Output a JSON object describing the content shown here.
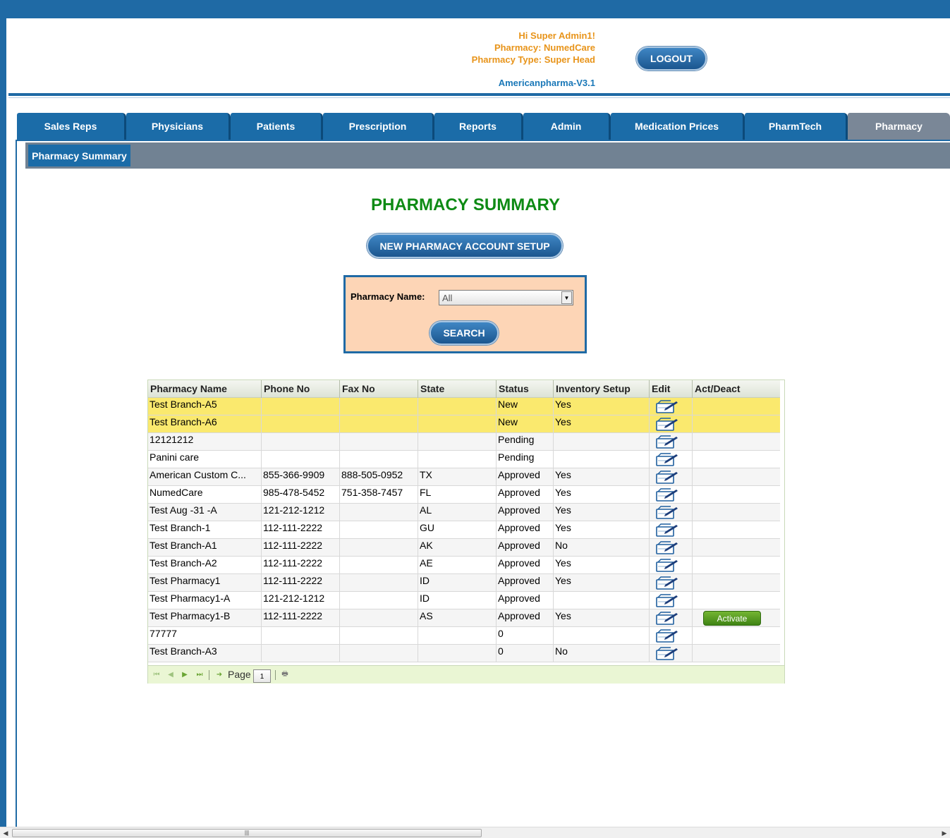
{
  "header": {
    "greeting": "Hi Super Admin1!",
    "pharmacy": "Pharmacy: NumedCare",
    "pharmacy_type": "Pharmacy Type: Super Head",
    "version": "Americanpharma-V3.1",
    "logout_label": "LOGOUT"
  },
  "nav": {
    "tabs": [
      {
        "label": "Sales Reps"
      },
      {
        "label": "Physicians"
      },
      {
        "label": "Patients"
      },
      {
        "label": "Prescription"
      },
      {
        "label": "Reports"
      },
      {
        "label": "Admin"
      },
      {
        "label": "Medication Prices"
      },
      {
        "label": "PharmTech"
      },
      {
        "label": "Pharmacy"
      }
    ],
    "active_tab": "Pharmacy"
  },
  "subnav": {
    "label": "Pharmacy Summary"
  },
  "main": {
    "title": "PHARMACY SUMMARY",
    "new_button_label": "NEW PHARMACY ACCOUNT SETUP",
    "search": {
      "label": "Pharmacy Name:",
      "selected": "All",
      "button_label": "SEARCH"
    }
  },
  "grid": {
    "columns": [
      "Pharmacy Name",
      "Phone No",
      "Fax No",
      "State",
      "Status",
      "Inventory Setup",
      "Edit",
      "Act/Deact"
    ],
    "rows": [
      {
        "name": "Test Branch-A5",
        "phone": "",
        "fax": "",
        "state": "",
        "status": "New",
        "inventory": "Yes",
        "action": ""
      },
      {
        "name": "Test Branch-A6",
        "phone": "",
        "fax": "",
        "state": "",
        "status": "New",
        "inventory": "Yes",
        "action": ""
      },
      {
        "name": "12121212",
        "phone": "",
        "fax": "",
        "state": "",
        "status": "Pending",
        "inventory": "",
        "action": ""
      },
      {
        "name": "Panini care",
        "phone": "",
        "fax": "",
        "state": "",
        "status": "Pending",
        "inventory": "",
        "action": ""
      },
      {
        "name": "American Custom C...",
        "phone": "855-366-9909",
        "fax": "888-505-0952",
        "state": "TX",
        "status": "Approved",
        "inventory": "Yes",
        "action": ""
      },
      {
        "name": "NumedCare",
        "phone": "985-478-5452",
        "fax": "751-358-7457",
        "state": "FL",
        "status": "Approved",
        "inventory": "Yes",
        "action": ""
      },
      {
        "name": "Test Aug -31 -A",
        "phone": "121-212-1212",
        "fax": "",
        "state": "AL",
        "status": "Approved",
        "inventory": "Yes",
        "action": ""
      },
      {
        "name": "Test Branch-1",
        "phone": "112-111-2222",
        "fax": "",
        "state": "GU",
        "status": "Approved",
        "inventory": "Yes",
        "action": ""
      },
      {
        "name": "Test Branch-A1",
        "phone": "112-111-2222",
        "fax": "",
        "state": "AK",
        "status": "Approved",
        "inventory": "No",
        "action": ""
      },
      {
        "name": "Test Branch-A2",
        "phone": "112-111-2222",
        "fax": "",
        "state": "AE",
        "status": "Approved",
        "inventory": "Yes",
        "action": ""
      },
      {
        "name": "Test Pharmacy1",
        "phone": "112-111-2222",
        "fax": "",
        "state": "ID",
        "status": "Approved",
        "inventory": "Yes",
        "action": ""
      },
      {
        "name": "Test Pharmacy1-A",
        "phone": "121-212-1212",
        "fax": "",
        "state": "ID",
        "status": "Approved",
        "inventory": "",
        "action": ""
      },
      {
        "name": "Test Pharmacy1-B",
        "phone": "112-111-2222",
        "fax": "",
        "state": "AS",
        "status": "Approved",
        "inventory": "Yes",
        "action": "Activate"
      },
      {
        "name": "77777",
        "phone": "",
        "fax": "",
        "state": "",
        "status": "0",
        "inventory": "",
        "action": ""
      },
      {
        "name": "Test Branch-A3",
        "phone": "",
        "fax": "",
        "state": "",
        "status": "0",
        "inventory": "No",
        "action": ""
      }
    ],
    "pager": {
      "page_label": "Page",
      "page_value": "1"
    }
  },
  "colors": {
    "primary_blue": "#1f6aa5",
    "title_green": "#0e8a14",
    "user_info_orange": "#e8941a",
    "highlight_row": "#fae96e",
    "search_box_bg": "#fdd5b6",
    "activate_green": "#4f9a1e"
  }
}
